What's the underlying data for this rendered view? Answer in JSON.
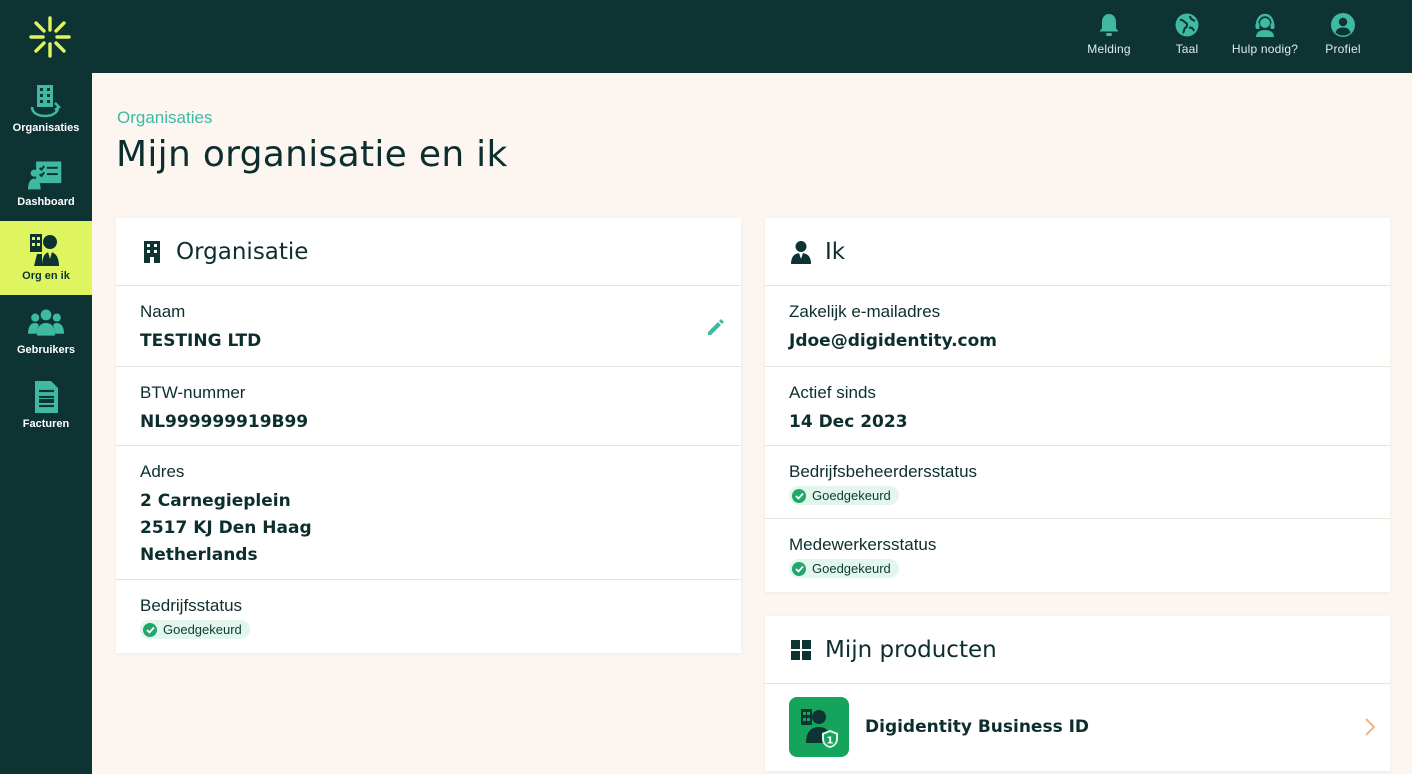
{
  "topbar": {
    "actions": [
      {
        "label": "Melding",
        "icon": "bell-icon"
      },
      {
        "label": "Taal",
        "icon": "globe-icon"
      },
      {
        "label": "Hulp nodig?",
        "icon": "headset-icon"
      },
      {
        "label": "Profiel",
        "icon": "user-circle-icon"
      }
    ]
  },
  "sidebar": {
    "items": [
      {
        "label": "Organisaties",
        "icon": "organisations-icon",
        "active": false
      },
      {
        "label": "Dashboard",
        "icon": "dashboard-icon",
        "active": false
      },
      {
        "label": "Org en ik",
        "icon": "org-and-me-icon",
        "active": true
      },
      {
        "label": "Gebruikers",
        "icon": "users-icon",
        "active": false
      },
      {
        "label": "Facturen",
        "icon": "invoice-icon",
        "active": false
      }
    ]
  },
  "page": {
    "breadcrumb": "Organisaties",
    "title": "Mijn organisatie en ik"
  },
  "organisation": {
    "title": "Organisatie",
    "name_label": "Naam",
    "name_value": "TESTING LTD",
    "vat_label": "BTW-nummer",
    "vat_value": "NL999999919B99",
    "address_label": "Adres",
    "address_lines": [
      "2 Carnegieplein",
      "2517 KJ Den Haag",
      "Netherlands"
    ],
    "status_label": "Bedrijfsstatus",
    "status_value": "Goedgekeurd"
  },
  "me": {
    "title": "Ik",
    "email_label": "Zakelijk e-mailadres",
    "email_value": "Jdoe@digidentity.com",
    "since_label": "Actief sinds",
    "since_value": "14 Dec 2023",
    "admin_status_label": "Bedrijfsbeheerdersstatus",
    "admin_status_value": "Goedgekeurd",
    "employee_status_label": "Medewerkersstatus",
    "employee_status_value": "Goedgekeurd"
  },
  "products": {
    "title": "Mijn producten",
    "items": [
      {
        "name": "Digidentity Business ID",
        "icon": "business-id-icon",
        "badge": "1"
      }
    ]
  },
  "colors": {
    "dark": "#0d3333",
    "accent": "#dff55f",
    "teal": "#3fb9a0",
    "background": "#fdf5ef",
    "success": "#1fa86a",
    "product_green": "#16a45c"
  }
}
